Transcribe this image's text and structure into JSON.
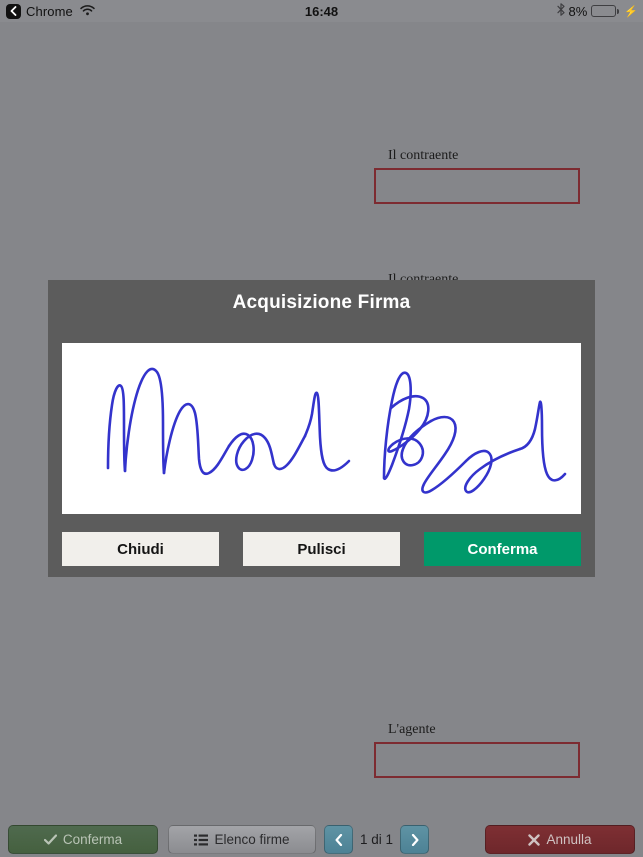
{
  "statusbar": {
    "back_label": "Chrome",
    "back_icon": "chevron-left-icon",
    "wifi_icon": "wifi-icon",
    "time": "16:48",
    "bluetooth_icon": "bluetooth-icon",
    "battery_percent": "8%",
    "battery_level": 8,
    "battery_charging": true,
    "battery_color": "#e04a3f"
  },
  "document": {
    "fields": [
      {
        "label": "Il contraente",
        "value": ""
      },
      {
        "label": "Il contraente",
        "value": ""
      },
      {
        "label": "L'agente",
        "value": ""
      }
    ],
    "field_border_color": "#7d2b31"
  },
  "modal": {
    "title": "Acquisizione Firma",
    "signature": {
      "present": true,
      "ink_color": "#3333cc",
      "description": "Mario Rossi"
    },
    "buttons": {
      "close": "Chiudi",
      "clear": "Pulisci",
      "confirm": "Conferma"
    },
    "confirm_color": "#00996a",
    "background_color": "#5c5c5c"
  },
  "toolbar": {
    "confirm_label": "Conferma",
    "confirm_icon": "check-icon",
    "confirm_enabled": false,
    "list_label": "Elenco firme",
    "list_icon": "list-icon",
    "prev_icon": "chevron-left-icon",
    "next_icon": "chevron-right-icon",
    "page_indicator": "1 di 1",
    "cancel_label": "Annulla",
    "cancel_icon": "close-x-icon",
    "cancel_color": "#7e2f33"
  }
}
